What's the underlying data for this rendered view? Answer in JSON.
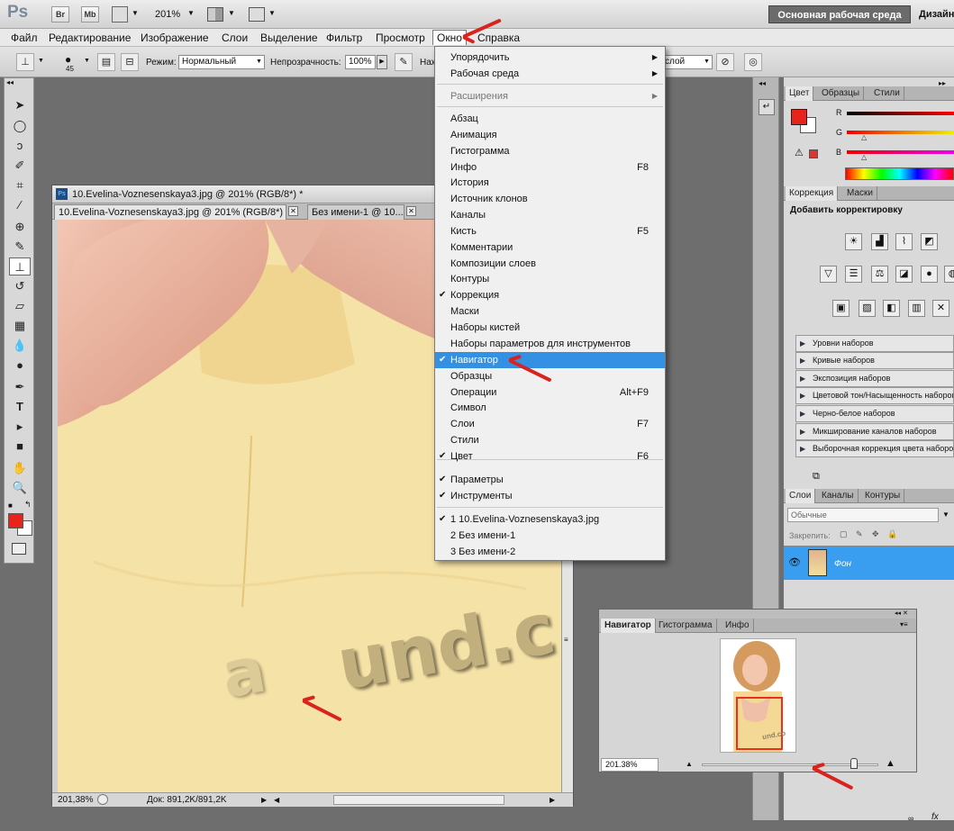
{
  "appbar": {
    "logo": "Ps",
    "bridge": "Br",
    "minibridge": "Mb",
    "zoom": "201%",
    "workspace_button": "Основная рабочая среда",
    "workspace_cut": "Дизайн"
  },
  "menubar": {
    "items": [
      "Файл",
      "Редактирование",
      "Изображение",
      "Слои",
      "Выделение",
      "Фильтр",
      "Просмотр",
      "Окно",
      "Справка"
    ]
  },
  "options": {
    "brush_size": "45",
    "mode_label": "Режим:",
    "mode_value": "Нормальный",
    "opacity_label": "Непрозрачность:",
    "opacity_value": "100%",
    "flow_label_cut": "Наж",
    "sample_value_cut": "слой"
  },
  "document": {
    "title": "10.Evelina-Voznesenskaya3.jpg @ 201% (RGB/8*) *",
    "tab1": "10.Evelina-Voznesenskaya3.jpg @ 201% (RGB/8*) *",
    "tab2": "Без имени-1 @ 10...",
    "watermark": "und.c",
    "watermark_a": "a",
    "status_zoom": "201,38%",
    "status_doc": "Док: 891,2K/891,2K"
  },
  "dropdown": {
    "items": [
      {
        "label": "Упорядочить",
        "submenu": true
      },
      {
        "label": "Рабочая среда",
        "submenu": true
      },
      {
        "label": "Расширения",
        "submenu": true,
        "disabled": true
      },
      {
        "label": "Абзац"
      },
      {
        "label": "Анимация"
      },
      {
        "label": "Гистограмма"
      },
      {
        "label": "Инфо",
        "shortcut": "F8"
      },
      {
        "label": "История"
      },
      {
        "label": "Источник клонов"
      },
      {
        "label": "Каналы"
      },
      {
        "label": "Кисть",
        "shortcut": "F5"
      },
      {
        "label": "Комментарии"
      },
      {
        "label": "Композиции слоев"
      },
      {
        "label": "Контуры"
      },
      {
        "label": "Коррекция",
        "checked": true
      },
      {
        "label": "Маски"
      },
      {
        "label": "Наборы кистей"
      },
      {
        "label": "Наборы параметров для инструментов"
      },
      {
        "label": "Навигатор",
        "checked": true,
        "highlighted": true
      },
      {
        "label": "Образцы"
      },
      {
        "label": "Операции",
        "shortcut": "Alt+F9"
      },
      {
        "label": "Символ"
      },
      {
        "label": "Слои",
        "shortcut": "F7"
      },
      {
        "label": "Стили"
      },
      {
        "label": "Цвет",
        "checked": true,
        "shortcut": "F6"
      },
      {
        "label": "Параметры",
        "checked": true
      },
      {
        "label": "Инструменты",
        "checked": true
      },
      {
        "label": "1 10.Evelina-Voznesenskaya3.jpg",
        "checked": true
      },
      {
        "label": "2 Без имени-1"
      },
      {
        "label": "3 Без имени-2"
      }
    ]
  },
  "color_panel": {
    "tabs": [
      "Цвет",
      "Образцы",
      "Стили"
    ],
    "r": "R",
    "g": "G",
    "b": "B",
    "foreground": "#e8231c"
  },
  "adjust_panel": {
    "tabs": [
      "Коррекция",
      "Маски"
    ],
    "heading": "Добавить корректировку",
    "presets": [
      "Уровни наборов",
      "Кривые наборов",
      "Экспозиция наборов",
      "Цветовой тон/Насыщенность наборов",
      "Черно-белое наборов",
      "Микширование каналов наборов",
      "Выборочная коррекция цвета наборов"
    ]
  },
  "layers_panel": {
    "tabs": [
      "Слои",
      "Каналы",
      "Контуры"
    ],
    "blend": "Обычные",
    "lock_label": "Закрепить:",
    "layer_name": "Фон",
    "fx": "fx"
  },
  "navigator": {
    "tabs": [
      "Навигатор",
      "Гистограмма",
      "Инфо"
    ],
    "zoom": "201.38%",
    "thumb_watermark": "und.co",
    "zoom_level": 0.86
  },
  "colors": {
    "highlight": "#3390e2",
    "arrow": "#d9231e",
    "layer_selected": "#3a9ef0"
  }
}
